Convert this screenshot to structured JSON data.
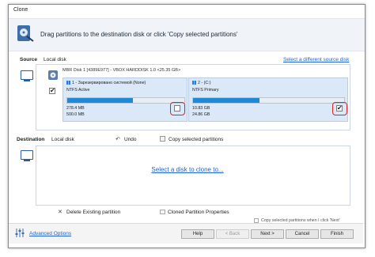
{
  "window": {
    "title": "Clone"
  },
  "header": {
    "instruction": "Drag partitions to the destination disk or click 'Copy selected partitions'"
  },
  "source": {
    "label": "Source",
    "disk_label": "Local disk",
    "select_link": "Select a different source disk",
    "disk_info": "MBR Disk 1 [4389E977] - VBOX HARDDISK 1.0  <25.35 GB>",
    "partitions": [
      {
        "title": "1 - Зарезервировано системой (None)",
        "fs": "NTFS Active",
        "used": "278.4 MB",
        "total": "500.0 MB",
        "fill": 0.56,
        "checked": false
      },
      {
        "title": "2 - (C:)",
        "fs": "NTFS Primary",
        "used": "10.83 GB",
        "total": "24.86 GB",
        "fill": 0.44,
        "checked": true
      }
    ]
  },
  "destination": {
    "label": "Destination",
    "disk_label": "Local disk",
    "undo_label": "Undo",
    "copy_label": "Copy selected partitions",
    "select_link": "Select a disk to clone to..."
  },
  "legend": {
    "delete_label": "Delete Existing partition",
    "cloned_label": "Cloned Partition Properties"
  },
  "options": {
    "copy_next_label": "Copy selected partitions when I click 'Next'",
    "copy_next_checked": false
  },
  "footer": {
    "advanced_label": "Advanced Options",
    "help": "Help",
    "back": "< Back",
    "next": "Next >",
    "cancel": "Cancel",
    "finish": "Finish"
  }
}
